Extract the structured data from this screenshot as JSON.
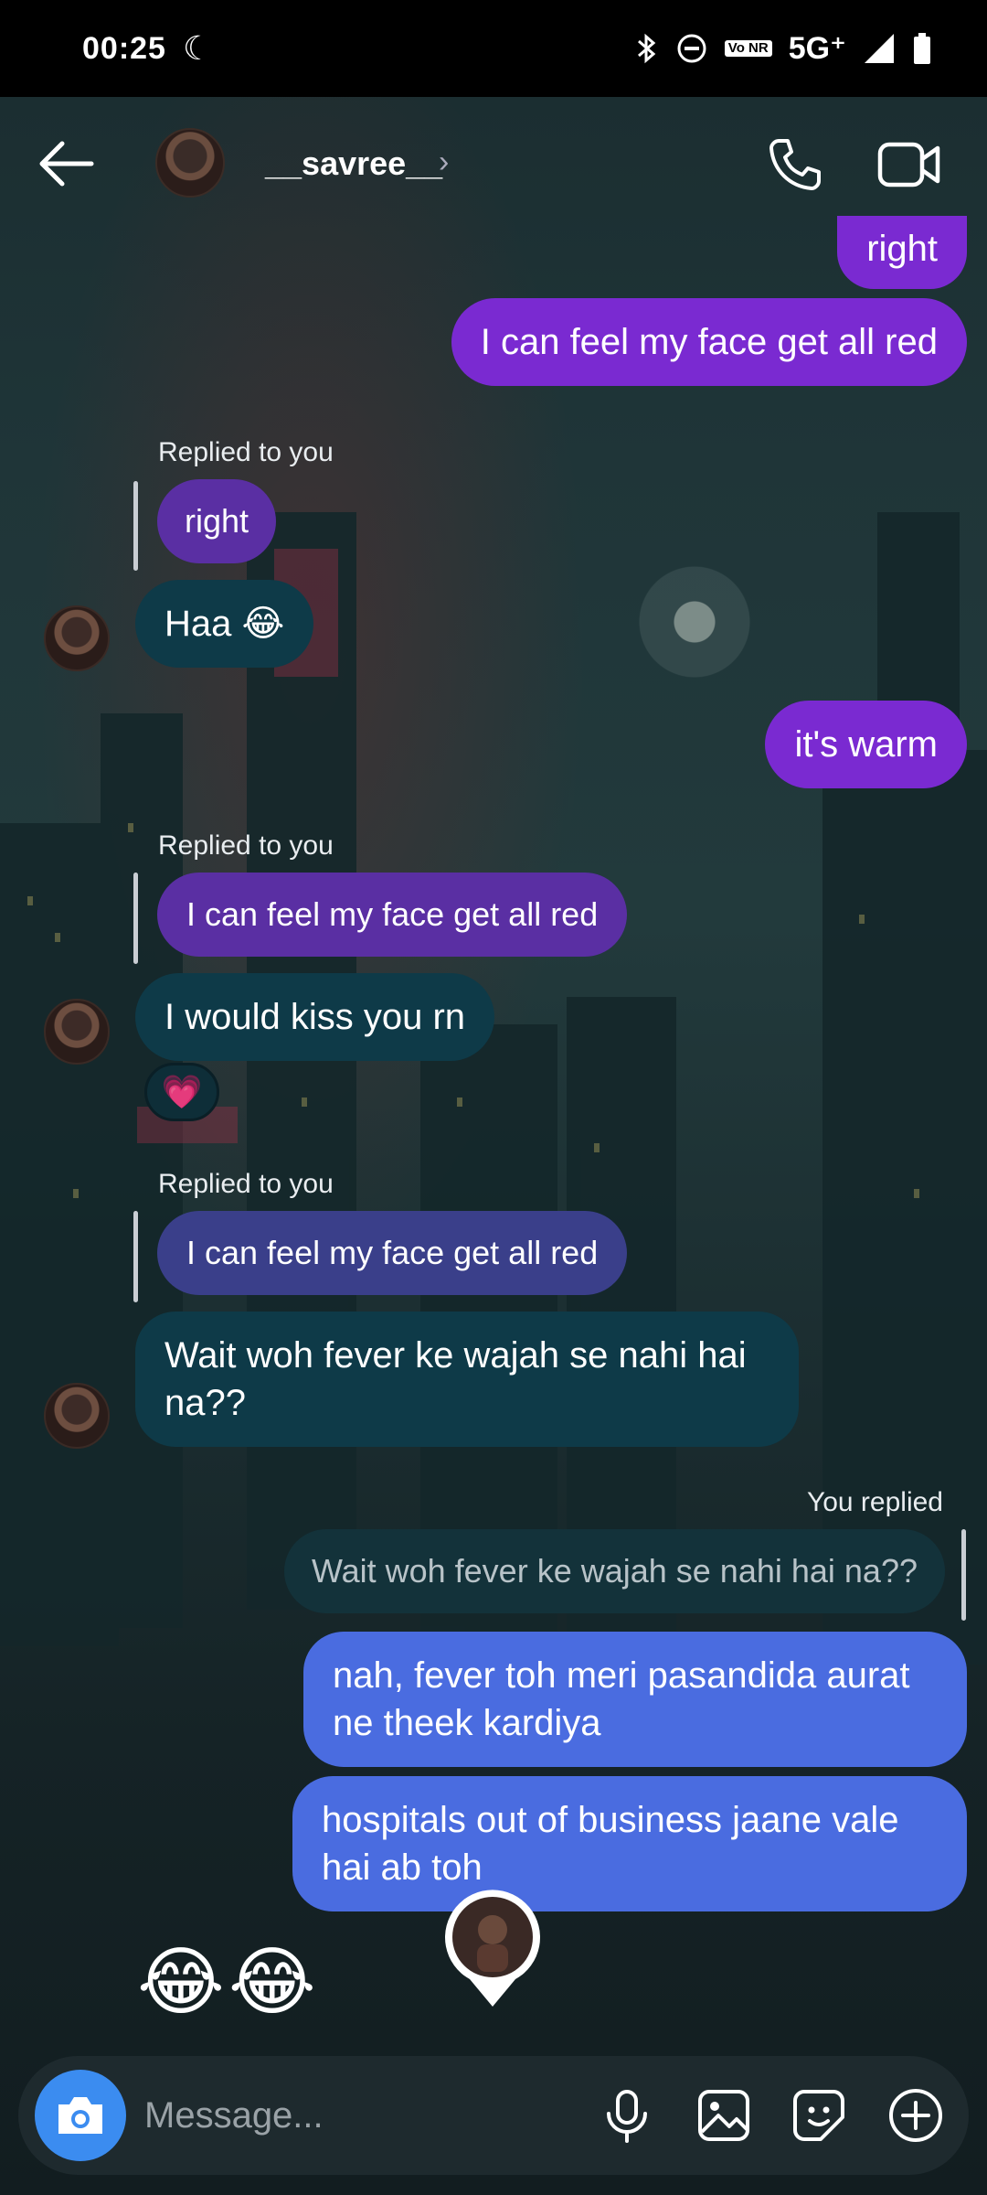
{
  "status_bar": {
    "time": "00:25",
    "network": "5G⁺",
    "volte": "Vo NR"
  },
  "header": {
    "contact_name": "__savree__",
    "chevron": "›"
  },
  "messages": {
    "m1_right": "right",
    "m2_face": "I can feel my face get all red",
    "reply1_label": "Replied to you",
    "reply1_ref": "right",
    "m3_haa": "Haa 😂",
    "m4_warm": "it's warm",
    "reply2_label": "Replied to you",
    "reply2_ref": "I can feel my face get all red",
    "m5_kiss": "I would kiss you rn",
    "m5_reaction": "💗",
    "reply3_label": "Replied to you",
    "reply3_ref": "I can feel my face get all red",
    "m6_fever": "Wait woh fever ke wajah se nahi hai na??",
    "you_replied_label": "You replied",
    "you_replied_ref": "Wait woh fever ke wajah se nahi hai na??",
    "m7_nah": "nah, fever toh meri pasandida aurat ne theek kardiya",
    "m8_hospitals": "hospitals out of business jaane vale hai ab toh",
    "emoji_message": "😂😂"
  },
  "composer": {
    "placeholder": "Message..."
  },
  "colors": {
    "my_bubble": "#7a2ad1",
    "their_bubble": "#0e3a48",
    "blue_bubble": "#4a6ce0",
    "camera_button": "#3b8cf0"
  },
  "icons": [
    "back-arrow-icon",
    "moon-icon",
    "bluetooth-icon",
    "dnd-icon",
    "signal-icon",
    "battery-icon",
    "phone-icon",
    "video-camera-icon",
    "camera-icon",
    "microphone-icon",
    "gallery-icon",
    "sticker-icon",
    "plus-icon"
  ]
}
